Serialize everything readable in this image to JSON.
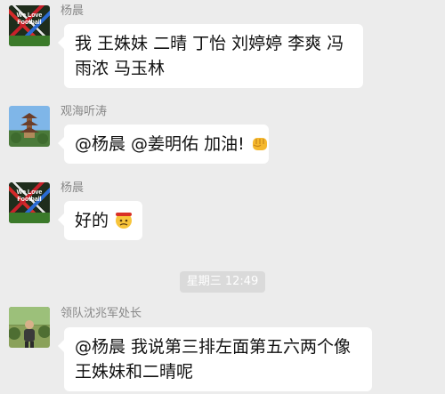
{
  "messages": [
    {
      "sender": "杨晨",
      "avatar_icon": "football-avatar-icon",
      "avatar_text": "We Love Football",
      "lines": [
        "我 王姝妹 二晴 丁怡 刘婷婷 李爽 冯",
        "雨浓 马玉林"
      ]
    },
    {
      "sender": "观海听涛",
      "avatar_icon": "pagoda-avatar-icon",
      "lines": [
        "@杨晨 @姜明佑 加油!"
      ],
      "emoji": "fist-emoji-icon"
    },
    {
      "sender": "杨晨",
      "avatar_icon": "football-avatar-icon",
      "avatar_text": "We Love Football",
      "lines": [
        "好的"
      ],
      "emoji": "determined-face-emoji-icon"
    },
    {
      "sender": "领队沈兆军处长",
      "avatar_icon": "person-avatar-icon",
      "lines": [
        "@杨晨 我说第三排左面第五六两个像",
        "王姝妹和二晴呢"
      ]
    }
  ],
  "timestamp": "星期三 12:49",
  "colors": {
    "background": "#ececec",
    "bubble": "#ffffff",
    "sender_text": "#888888",
    "timestamp_pill": "#dadada"
  }
}
